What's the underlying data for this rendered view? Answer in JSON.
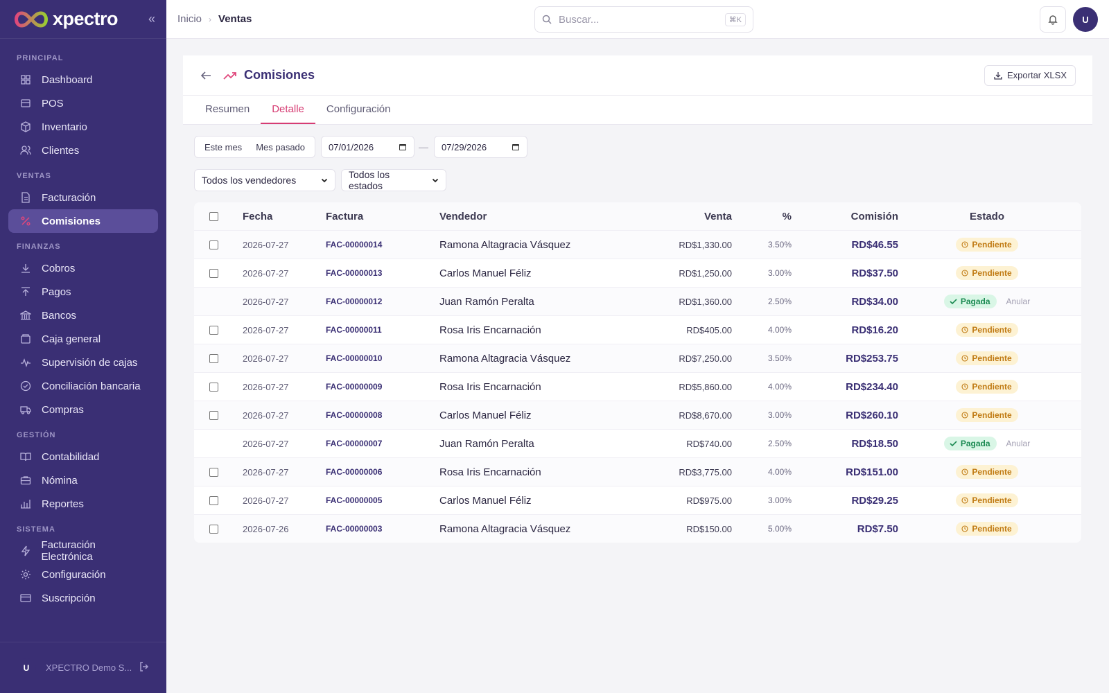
{
  "brand": {
    "name": "xpectro"
  },
  "sidebar": {
    "sections": [
      {
        "title": "PRINCIPAL",
        "items": [
          {
            "label": "Dashboard",
            "icon": "grid-icon"
          },
          {
            "label": "POS",
            "icon": "pos-icon"
          },
          {
            "label": "Inventario",
            "icon": "box-icon"
          },
          {
            "label": "Clientes",
            "icon": "users-icon"
          }
        ]
      },
      {
        "title": "VENTAS",
        "items": [
          {
            "label": "Facturación",
            "icon": "file-icon"
          },
          {
            "label": "Comisiones",
            "icon": "percent-icon",
            "active": true
          }
        ]
      },
      {
        "title": "FINANZAS",
        "items": [
          {
            "label": "Cobros",
            "icon": "download-icon"
          },
          {
            "label": "Pagos",
            "icon": "upload-icon"
          },
          {
            "label": "Bancos",
            "icon": "bank-icon"
          },
          {
            "label": "Caja general",
            "icon": "cashbox-icon"
          },
          {
            "label": "Supervisión de cajas",
            "icon": "pulse-icon"
          },
          {
            "label": "Conciliación bancaria",
            "icon": "check-circle-icon"
          },
          {
            "label": "Compras",
            "icon": "truck-icon"
          }
        ]
      },
      {
        "title": "GESTIÓN",
        "items": [
          {
            "label": "Contabilidad",
            "icon": "book-icon"
          },
          {
            "label": "Nómina",
            "icon": "briefcase-icon"
          },
          {
            "label": "Reportes",
            "icon": "bar-chart-icon"
          }
        ]
      },
      {
        "title": "SISTEMA",
        "items": [
          {
            "label": "Facturación Electrónica",
            "icon": "bolt-icon"
          },
          {
            "label": "Configuración",
            "icon": "gear-icon"
          },
          {
            "label": "Suscripción",
            "icon": "card-icon"
          }
        ]
      }
    ],
    "footer": {
      "avatar": "U",
      "name": "XPECTRO Demo S..."
    }
  },
  "topbar": {
    "breadcrumb": [
      "Inicio",
      "Ventas"
    ],
    "search_placeholder": "Buscar...",
    "search_shortcut": "⌘K",
    "avatar": "U"
  },
  "page": {
    "title": "Comisiones",
    "export_label": "Exportar XLSX",
    "tabs": [
      {
        "label": "Resumen",
        "active": false
      },
      {
        "label": "Detalle",
        "active": true
      },
      {
        "label": "Configuración",
        "active": false
      }
    ],
    "quick_filters": [
      "Este mes",
      "Mes pasado"
    ],
    "date_from": "07/01/2026",
    "date_to": "07/29/2026",
    "seller_filter": "Todos los vendedores",
    "state_filter": "Todos los estados"
  },
  "table": {
    "headers": {
      "date": "Fecha",
      "invoice": "Factura",
      "seller": "Vendedor",
      "sale": "Venta",
      "pct": "%",
      "commission": "Comisión",
      "state": "Estado"
    },
    "anular_label": "Anular",
    "rows": [
      {
        "date": "2026-07-27",
        "invoice": "FAC-00000014",
        "seller": "Ramona Altagracia Vásquez",
        "sale": "RD$1,330.00",
        "pct": "3.50%",
        "commission": "RD$46.55",
        "state": "Pendiente",
        "paid": false
      },
      {
        "date": "2026-07-27",
        "invoice": "FAC-00000013",
        "seller": "Carlos Manuel Féliz",
        "sale": "RD$1,250.00",
        "pct": "3.00%",
        "commission": "RD$37.50",
        "state": "Pendiente",
        "paid": false
      },
      {
        "date": "2026-07-27",
        "invoice": "FAC-00000012",
        "seller": "Juan Ramón Peralta",
        "sale": "RD$1,360.00",
        "pct": "2.50%",
        "commission": "RD$34.00",
        "state": "Pagada",
        "paid": true
      },
      {
        "date": "2026-07-27",
        "invoice": "FAC-00000011",
        "seller": "Rosa Iris Encarnación",
        "sale": "RD$405.00",
        "pct": "4.00%",
        "commission": "RD$16.20",
        "state": "Pendiente",
        "paid": false
      },
      {
        "date": "2026-07-27",
        "invoice": "FAC-00000010",
        "seller": "Ramona Altagracia Vásquez",
        "sale": "RD$7,250.00",
        "pct": "3.50%",
        "commission": "RD$253.75",
        "state": "Pendiente",
        "paid": false
      },
      {
        "date": "2026-07-27",
        "invoice": "FAC-00000009",
        "seller": "Rosa Iris Encarnación",
        "sale": "RD$5,860.00",
        "pct": "4.00%",
        "commission": "RD$234.40",
        "state": "Pendiente",
        "paid": false
      },
      {
        "date": "2026-07-27",
        "invoice": "FAC-00000008",
        "seller": "Carlos Manuel Féliz",
        "sale": "RD$8,670.00",
        "pct": "3.00%",
        "commission": "RD$260.10",
        "state": "Pendiente",
        "paid": false
      },
      {
        "date": "2026-07-27",
        "invoice": "FAC-00000007",
        "seller": "Juan Ramón Peralta",
        "sale": "RD$740.00",
        "pct": "2.50%",
        "commission": "RD$18.50",
        "state": "Pagada",
        "paid": true
      },
      {
        "date": "2026-07-27",
        "invoice": "FAC-00000006",
        "seller": "Rosa Iris Encarnación",
        "sale": "RD$3,775.00",
        "pct": "4.00%",
        "commission": "RD$151.00",
        "state": "Pendiente",
        "paid": false
      },
      {
        "date": "2026-07-27",
        "invoice": "FAC-00000005",
        "seller": "Carlos Manuel Féliz",
        "sale": "RD$975.00",
        "pct": "3.00%",
        "commission": "RD$29.25",
        "state": "Pendiente",
        "paid": false
      },
      {
        "date": "2026-07-26",
        "invoice": "FAC-00000003",
        "seller": "Ramona Altagracia Vásquez",
        "sale": "RD$150.00",
        "pct": "5.00%",
        "commission": "RD$7.50",
        "state": "Pendiente",
        "paid": false
      }
    ]
  },
  "colors": {
    "sidebar": "#3a2f74",
    "accent": "#d63c73",
    "pending": "#c07a12",
    "paid": "#1b8a52"
  }
}
